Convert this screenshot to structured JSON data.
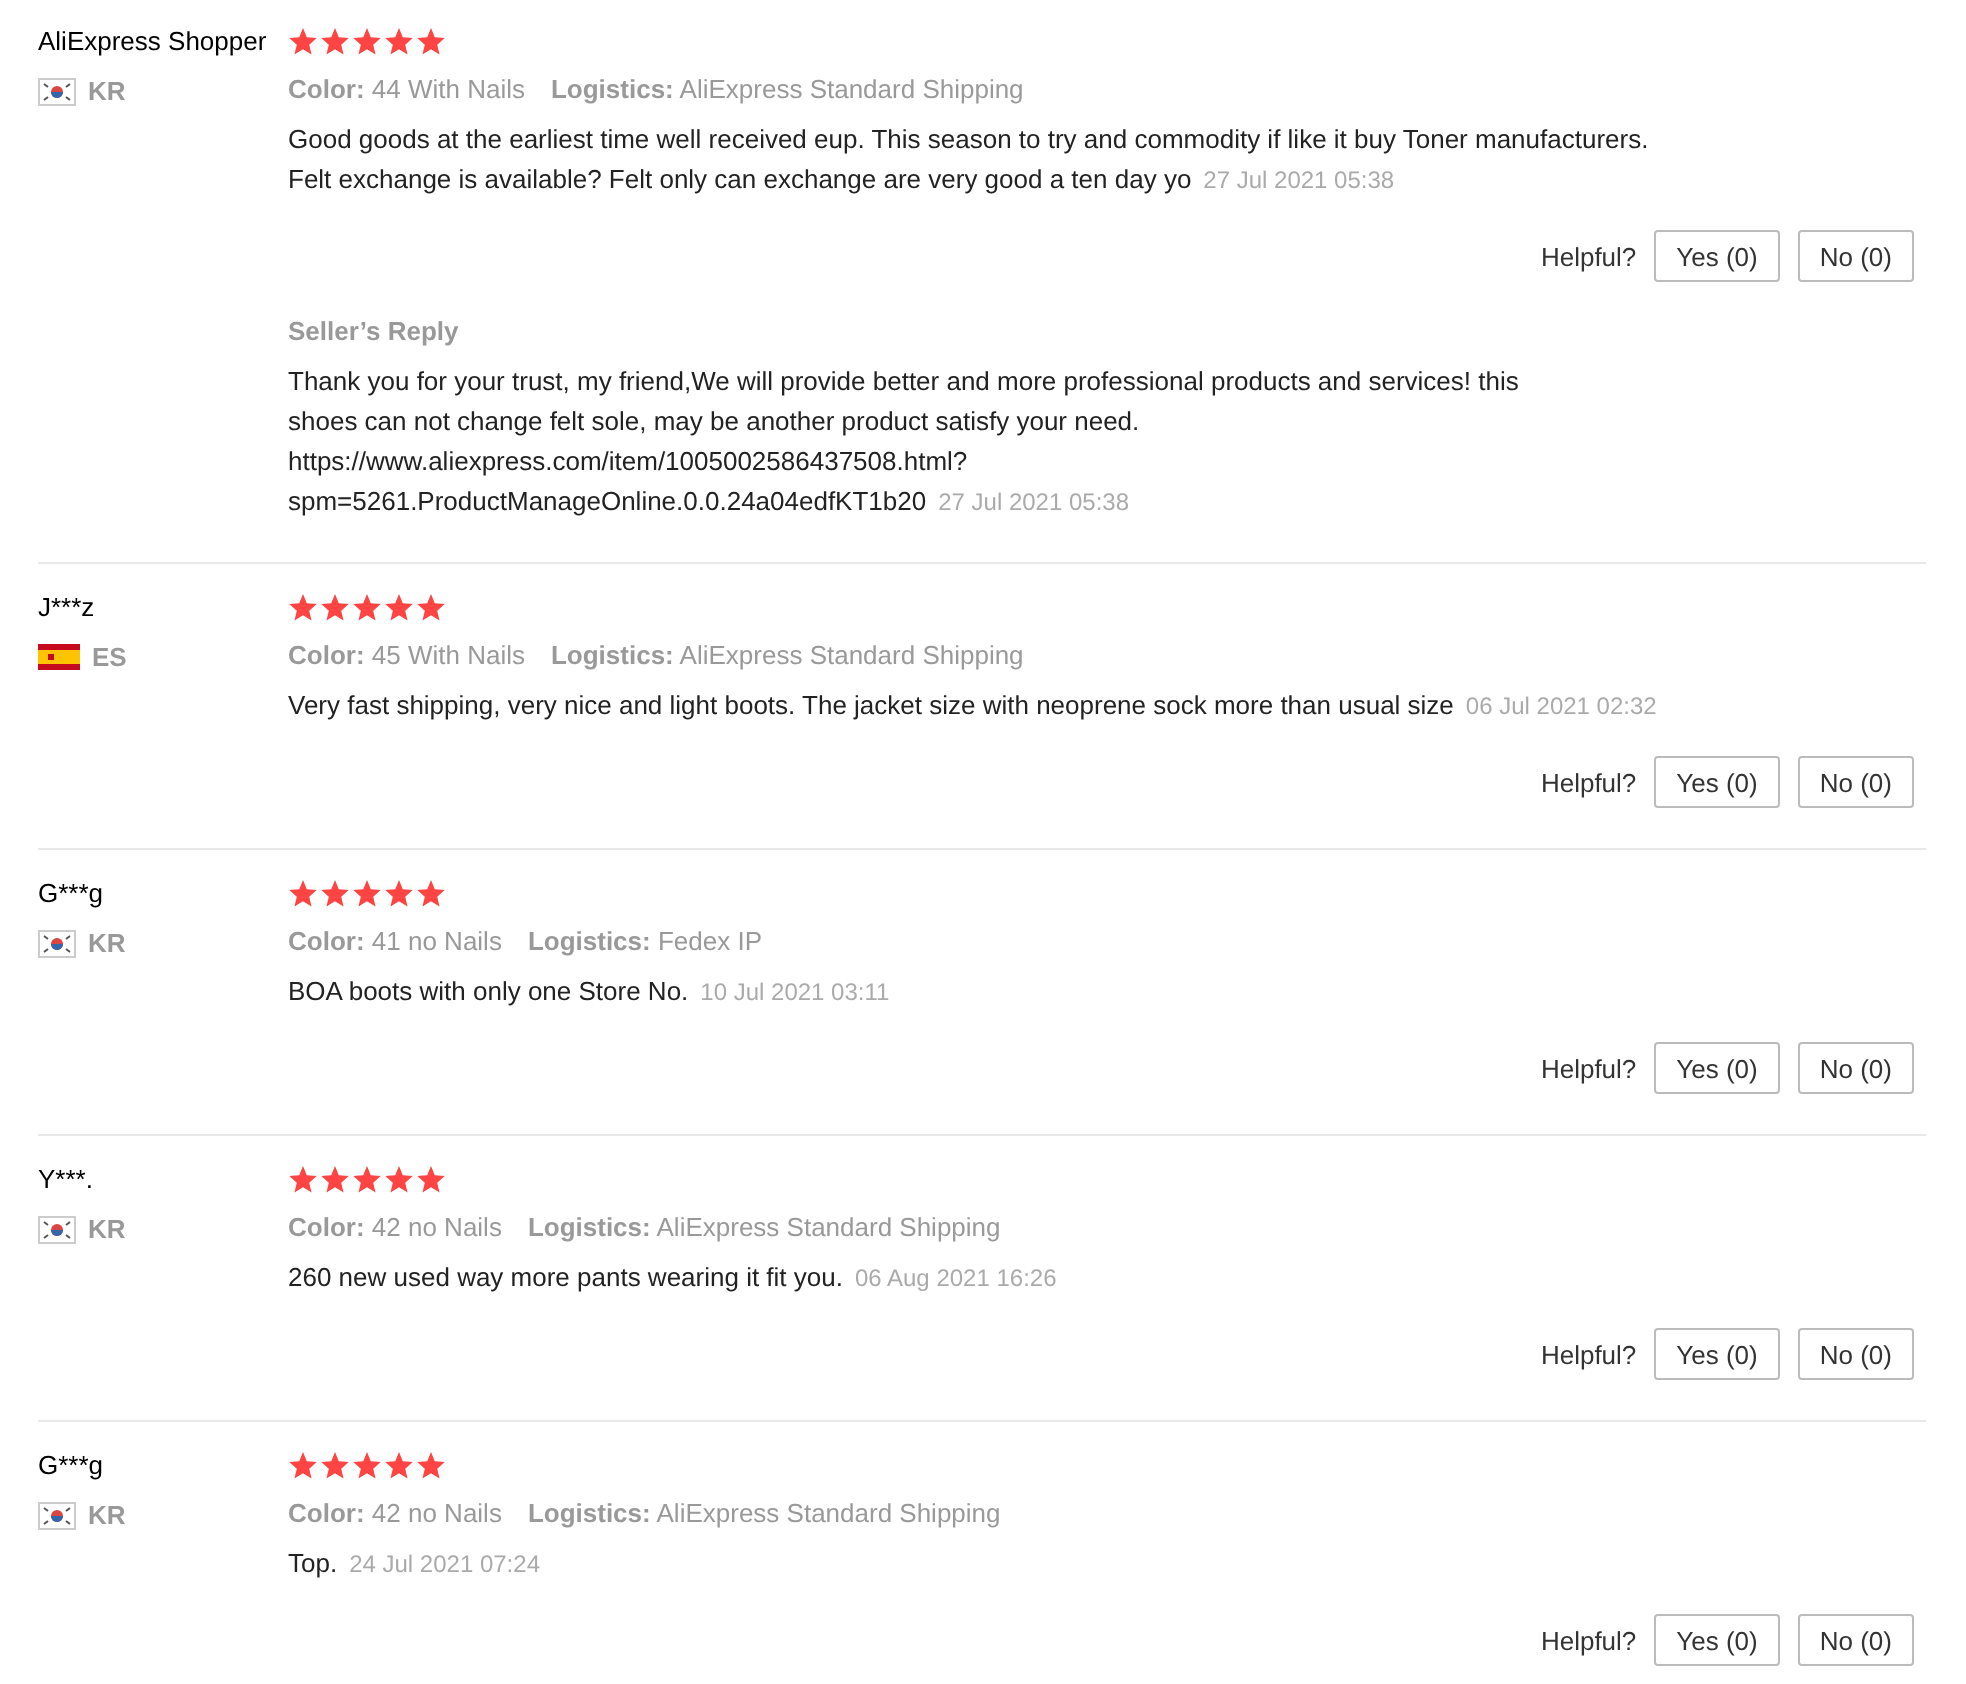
{
  "reviews": [
    {
      "name": "AliExpress Shopper",
      "stars": 5,
      "country": "KR",
      "flag": {
        "kind": "kr"
      },
      "meta": [
        {
          "label": "Color:",
          "value": "44 With Nails"
        },
        {
          "label": "Logistics:",
          "value": "AliExpress Standard Shipping"
        }
      ],
      "text_lines": [
        "Good goods at the earliest time well received eup. This season to try and commodity if like it buy Toner manufacturers.",
        "Felt exchange is available? Felt only can exchange are very good a ten day yo"
      ],
      "date": "27 Jul 2021 05:38",
      "helpful_label": "Helpful?",
      "yes": "Yes (0)",
      "no": "No (0)",
      "reply": {
        "title": "Seller’s Reply",
        "text_lines": [
          "Thank you for your trust, my friend,We will provide better and more professional products and services! this",
          "shoes can not change felt sole, may be another product satisfy your need.",
          "https://www.aliexpress.com/item/1005002586437508.html?",
          "spm=5261.ProductManageOnline.0.0.24a04edfKT1b20"
        ],
        "date": "27 Jul 2021 05:38"
      }
    },
    {
      "name": "J***z",
      "stars": 5,
      "country": "ES",
      "flag": {
        "kind": "es"
      },
      "meta": [
        {
          "label": "Color:",
          "value": "45 With Nails"
        },
        {
          "label": "Logistics:",
          "value": "AliExpress Standard Shipping"
        }
      ],
      "text_lines": [
        "Very fast shipping, very nice and light boots. The jacket size with neoprene sock more than usual size"
      ],
      "date": "06 Jul 2021 02:32",
      "helpful_label": "Helpful?",
      "yes": "Yes (0)",
      "no": "No (0)"
    },
    {
      "name": "G***g",
      "stars": 5,
      "country": "KR",
      "flag": {
        "kind": "kr"
      },
      "meta": [
        {
          "label": "Color:",
          "value": "41 no Nails"
        },
        {
          "label": "Logistics:",
          "value": "Fedex IP"
        }
      ],
      "text_lines": [
        "BOA boots with only one Store No."
      ],
      "date": "10 Jul 2021 03:11",
      "helpful_label": "Helpful?",
      "yes": "Yes (0)",
      "no": "No (0)"
    },
    {
      "name": "Y***.",
      "stars": 5,
      "country": "KR",
      "flag": {
        "kind": "kr"
      },
      "meta": [
        {
          "label": "Color:",
          "value": "42 no Nails"
        },
        {
          "label": "Logistics:",
          "value": "AliExpress Standard Shipping"
        }
      ],
      "text_lines": [
        "260 new used way more pants wearing it fit you."
      ],
      "date": "06 Aug 2021 16:26",
      "helpful_label": "Helpful?",
      "yes": "Yes (0)",
      "no": "No (0)"
    },
    {
      "name": "G***g",
      "stars": 5,
      "country": "KR",
      "flag": {
        "kind": "kr"
      },
      "meta": [
        {
          "label": "Color:",
          "value": "42 no Nails"
        },
        {
          "label": "Logistics:",
          "value": "AliExpress Standard Shipping"
        }
      ],
      "text_lines": [
        "Top."
      ],
      "date": "24 Jul 2021 07:24",
      "helpful_label": "Helpful?",
      "yes": "Yes (0)",
      "no": "No (0)"
    }
  ]
}
